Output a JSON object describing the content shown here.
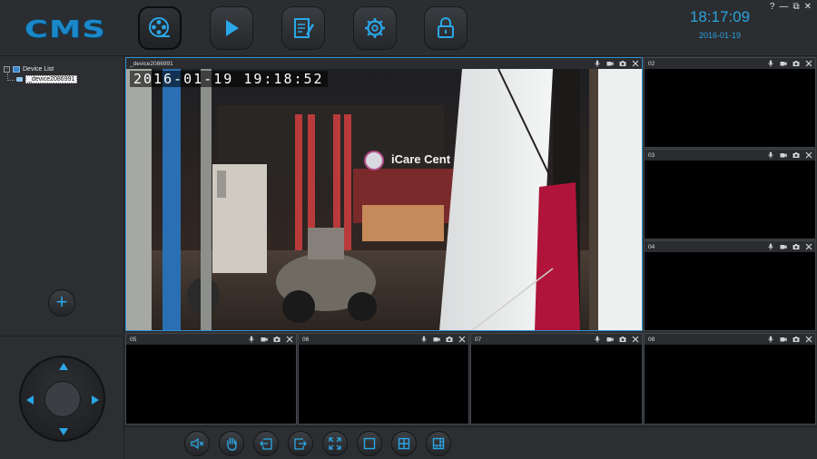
{
  "app": {
    "logo_text": "CMS"
  },
  "nav": [
    {
      "name": "live-view",
      "icon": "film-reel-icon",
      "active": true
    },
    {
      "name": "playback",
      "icon": "play-icon",
      "active": false
    },
    {
      "name": "log",
      "icon": "notepad-edit-icon",
      "active": false
    },
    {
      "name": "settings",
      "icon": "gear-icon",
      "active": false
    },
    {
      "name": "lock",
      "icon": "lock-icon",
      "active": false
    }
  ],
  "clock": {
    "time": "18:17:09",
    "date": "2016-01-19"
  },
  "window_controls": {
    "help": "?",
    "minimize": "—",
    "restore": "⧉",
    "close": "✕"
  },
  "device_tree": {
    "root_label": "Device List",
    "toggle": "-",
    "children": [
      "_device2086991"
    ]
  },
  "left_panel": {
    "add_label": "+"
  },
  "channels": {
    "main": {
      "label": "_device2086991",
      "osd": "2016-01-19   19:18:52",
      "sign_text": "iCare Cent"
    },
    "ch02": {
      "label": "02"
    },
    "ch03": {
      "label": "03"
    },
    "ch04": {
      "label": "04"
    },
    "ch05": {
      "label": "05"
    },
    "ch06": {
      "label": "06"
    },
    "ch07": {
      "label": "07"
    },
    "ch08": {
      "label": "08"
    }
  },
  "channel_icons": [
    "microphone-icon",
    "video-record-icon",
    "snapshot-camera-icon",
    "close-icon"
  ],
  "toolbar": [
    "mute-icon",
    "ptz-hand-icon",
    "previous-page-icon",
    "next-page-icon",
    "fullscreen-icon",
    "single-view-icon",
    "quad-view-icon",
    "multi-view-icon"
  ],
  "colors": {
    "accent": "#2aa7e8",
    "selected_border": "#2e8fd0",
    "background": "#2c2e31"
  }
}
